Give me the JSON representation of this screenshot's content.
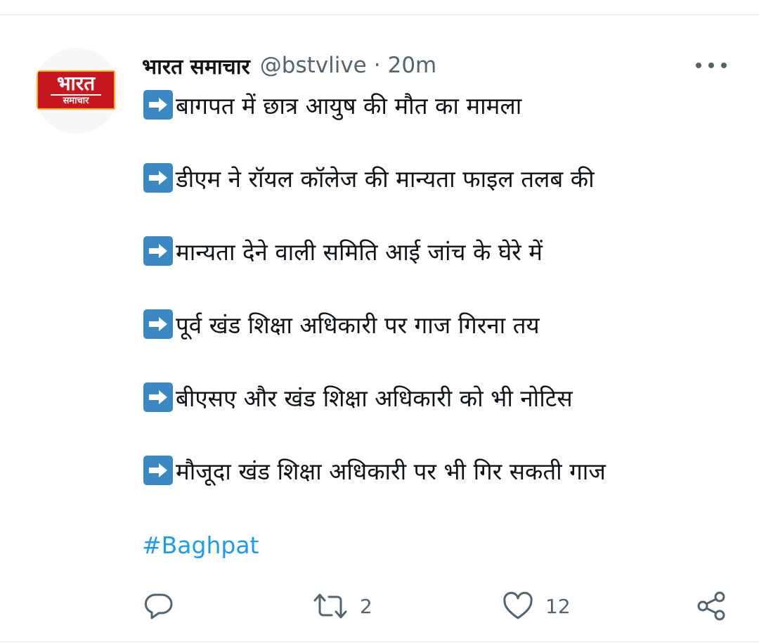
{
  "tweet": {
    "display_name": "भारत समाचार",
    "handle": "@bstvlive",
    "separator": "·",
    "time": "20m",
    "avatar_logo": {
      "main": "भारत",
      "sub": "समाचार",
      "brand_color": "#c8171e",
      "border_color": "#f0b42a"
    },
    "more_icon": "more-horizontal-icon",
    "arrow_icon": "right-arrow-emoji-icon",
    "lines": [
      "बागपत में छात्र आयुष की मौत का मामला",
      "डीएम ने रॉयल कॉलेज की मान्यता फाइल तलब की",
      "मान्यता देने वाली समिति आई जांच के घेरे में",
      "पूर्व खंड शिक्षा अधिकारी पर गाज गिरना तय",
      "बीएसए और खंड शिक्षा अधिकारी को भी नोटिस",
      "मौजूदा खंड शिक्षा अधिकारी पर भी गिर सकती गाज"
    ],
    "hashtag": "#Baghpat",
    "colors": {
      "text": "#0f1419",
      "secondary": "#536471",
      "link": "#1d9bf0",
      "arrow_bg": "#3b88c3"
    }
  },
  "actions": {
    "reply": {
      "icon": "reply-icon",
      "count": ""
    },
    "retweet": {
      "icon": "retweet-icon",
      "count": "2"
    },
    "like": {
      "icon": "heart-icon",
      "count": "12"
    },
    "share": {
      "icon": "share-icon"
    }
  }
}
